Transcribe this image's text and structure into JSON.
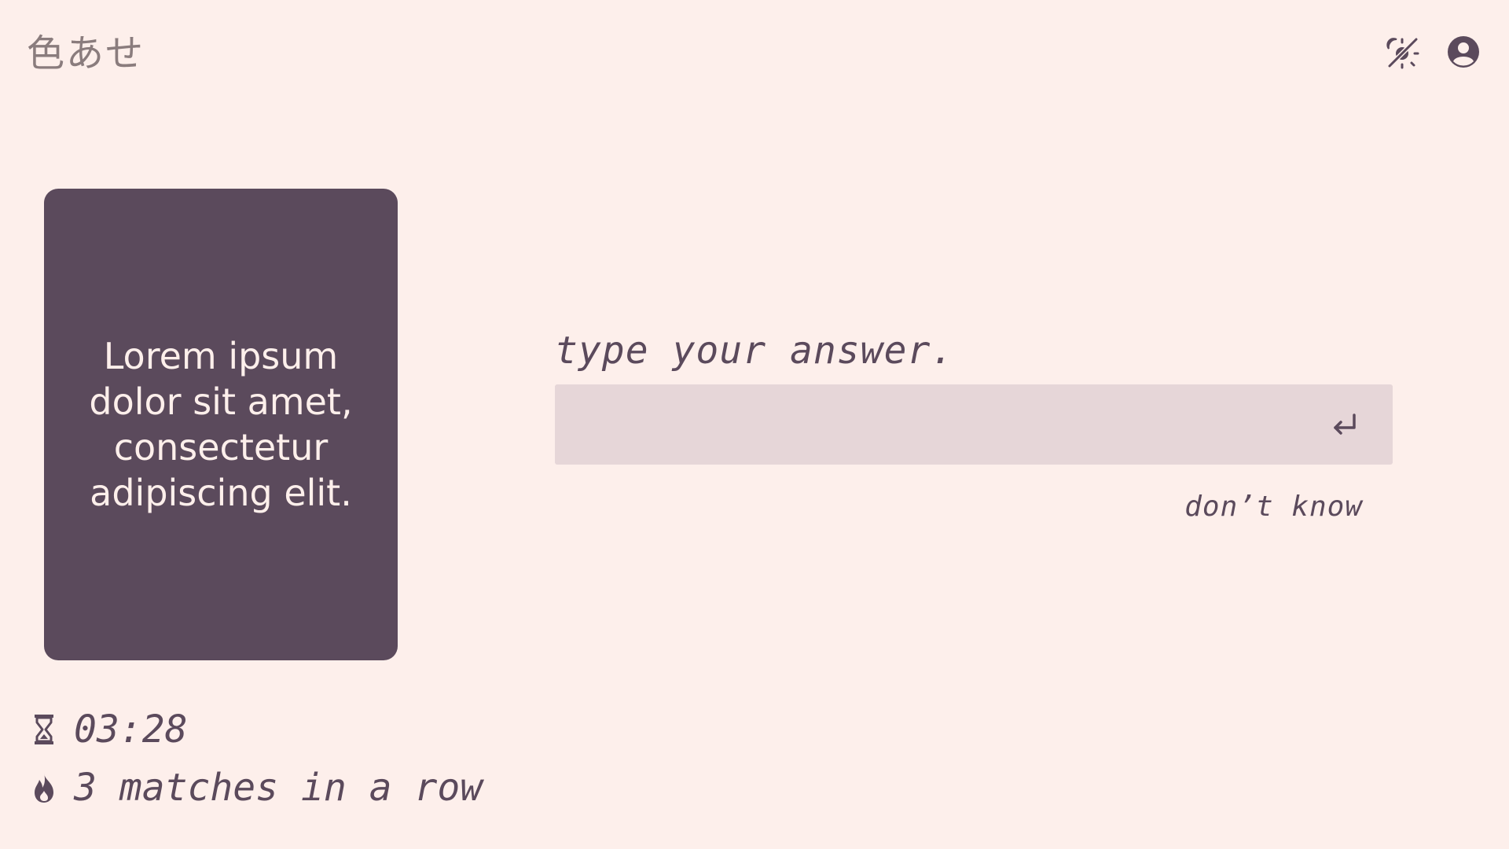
{
  "header": {
    "logo": "色あせ",
    "theme_toggle_icon": "theme-toggle-icon",
    "account_icon": "account-circle-icon"
  },
  "card": {
    "text": "Lorem ipsum dolor sit amet, consectetur adipiscing elit."
  },
  "answer": {
    "label": "type your answer.",
    "value": "",
    "placeholder": "",
    "submit_icon": "enter-return-icon",
    "dont_know": "don’t know"
  },
  "stats": {
    "timer": "03:28",
    "timer_icon": "hourglass-icon",
    "streak": "3 matches in a row",
    "streak_icon": "fire-icon"
  },
  "colors": {
    "background": "#fdefeb",
    "primary": "#5b4a5c",
    "input_background": "#e6d6d8",
    "logo": "#8a7c7d"
  }
}
